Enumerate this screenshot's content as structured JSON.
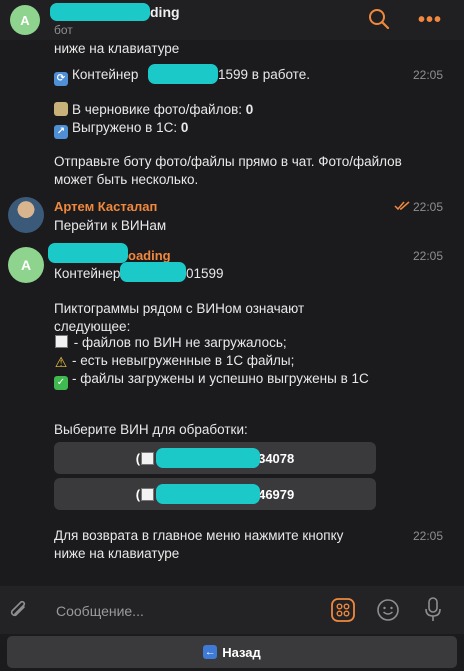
{
  "header": {
    "avatar_letter": "A",
    "title_suffix": "ding",
    "subtitle": "бот",
    "accent_color": "#f0883e"
  },
  "messages": {
    "m1": {
      "line_top": "ниже на клавиатуре",
      "status_prefix": "Контейнер",
      "status_suffix": "1599 в работе.",
      "time": "22:05",
      "draft_label": "В черновике фото/файлов:",
      "draft_count": "0",
      "uploaded_label": "Выгружено в 1С:",
      "uploaded_count": "0",
      "hint": "Отправьте боту фото/файлы прямо в чат. Фото/файлов может быть несколько."
    },
    "m2": {
      "sender": "Артем Касталап",
      "text": "Перейти к ВИНам",
      "time": "22:05"
    },
    "m3": {
      "avatar_letter": "A",
      "sender_suffix": "oading",
      "time": "22:05",
      "container_prefix": "Контейнер",
      "container_suffix": "01599",
      "legend_intro": "Пиктограммы рядом с ВИНом означают следующее:",
      "legend_1": "- файлов по ВИН не загружалось;",
      "legend_2": "- есть невыгруженные в 1С файлы;",
      "legend_3": "- файлы загружены и успешно выгружены в 1С",
      "choose": "Выберите ВИН для обработки:",
      "buttons": [
        {
          "prefix": "(",
          "suffix": "34078"
        },
        {
          "prefix": "(",
          "suffix": "46979"
        }
      ]
    },
    "m4": {
      "text": "Для возврата в главное меню нажмите кнопку ниже на клавиатуре",
      "time": "22:05"
    }
  },
  "composer": {
    "placeholder": "Сообщение..."
  },
  "reply_keyboard": {
    "back_label": "Назад"
  },
  "icons": {
    "search": "search-icon",
    "menu": "more-dots-icon",
    "attach": "paperclip-icon",
    "bot_commands": "bot-commands-icon",
    "emoji": "emoji-icon",
    "mic": "microphone-icon"
  }
}
